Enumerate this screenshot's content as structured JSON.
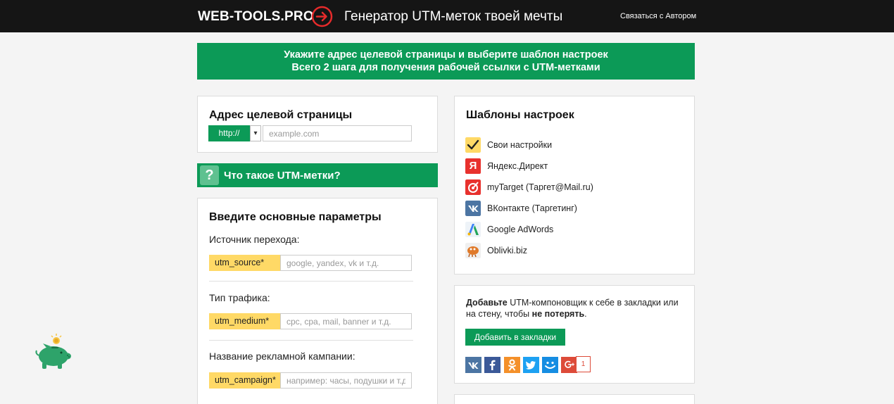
{
  "header": {
    "logo": "WEB-TOOLS.PRO",
    "tagline": "Генератор UTM-меток твоей мечты",
    "contact": "Связаться с Автором"
  },
  "banner": {
    "line1": "Укажите адрес целевой страницы и выберите шаблон настроек",
    "line2": "Всего 2 шага для получения рабочей ссылки с UTM-метками"
  },
  "address": {
    "title": "Адрес целевой страницы",
    "protocol": "http://",
    "placeholder": "example.com"
  },
  "help": {
    "icon_glyph": "?",
    "label": "Что такое UTM-метки?"
  },
  "params": {
    "title": "Введите основные параметры",
    "fields": [
      {
        "label": "Источник перехода:",
        "tag": "utm_source*",
        "placeholder": "google, yandex, vk и т.д."
      },
      {
        "label": "Тип трафика:",
        "tag": "utm_medium*",
        "placeholder": "cpc, cpa, mail, banner и т.д."
      },
      {
        "label": "Название рекламной кампании:",
        "tag": "utm_campaign*",
        "placeholder": "например: часы, подушки и т.д."
      }
    ]
  },
  "templates": {
    "title": "Шаблоны настроек",
    "items": [
      {
        "label": "Свои настройки",
        "icon": "checkmark-icon",
        "color": "#ffd966"
      },
      {
        "label": "Яндекс.Директ",
        "icon": "yandex-icon",
        "color": "#e8312d",
        "glyph": "Я"
      },
      {
        "label": "myTarget (Таргет@Mail.ru)",
        "icon": "mytarget-icon",
        "color": "#e8312d"
      },
      {
        "label": "ВКонтакте (Таргетинг)",
        "icon": "vk-icon",
        "color": "#4c75a3"
      },
      {
        "label": "Google AdWords",
        "icon": "adwords-icon",
        "color": "#3b82f6"
      },
      {
        "label": "Oblivki.biz",
        "icon": "oblivki-icon",
        "color": "#e07a2a"
      }
    ]
  },
  "bookmarks": {
    "bold1": "Добавьте",
    "text1": " UTM-компоновщик к себе в закладки или на стену, чтобы ",
    "bold2": "не потерять",
    "text2": ".",
    "button": "Добавить в закладки",
    "share": [
      {
        "name": "vk-share-icon",
        "color": "#4c75a3"
      },
      {
        "name": "facebook-share-icon",
        "color": "#3b5998"
      },
      {
        "name": "odnoklassniki-share-icon",
        "color": "#f4902a"
      },
      {
        "name": "twitter-share-icon",
        "color": "#1da1f2"
      },
      {
        "name": "moimir-share-icon",
        "color": "#168de2"
      },
      {
        "name": "google-plus-share-icon",
        "color": "#dd4b39"
      }
    ],
    "google_count": "1"
  },
  "colors": {
    "accent": "#0c9a57",
    "tag": "#ffd966",
    "topbar": "#151515"
  }
}
